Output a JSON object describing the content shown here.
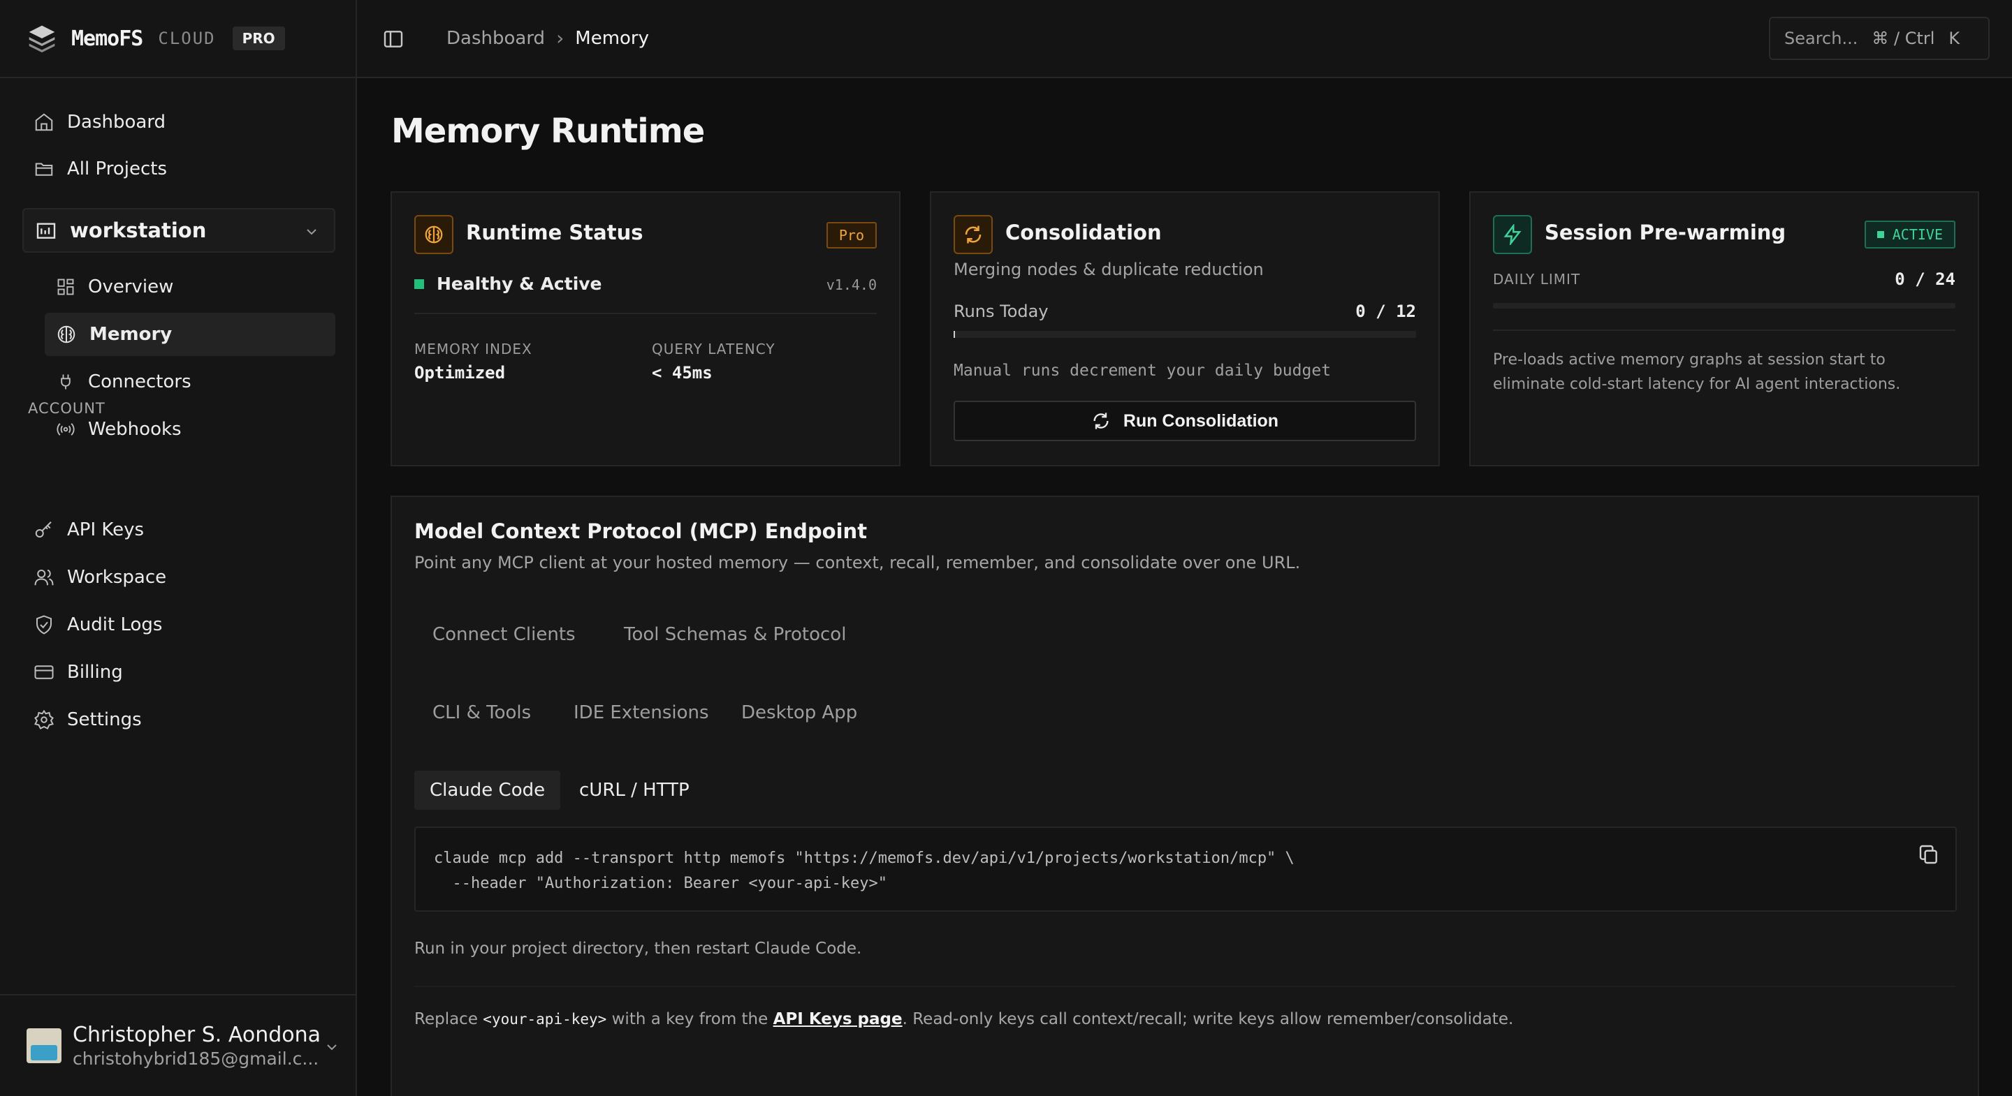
{
  "brand": {
    "name": "MemoFS",
    "suffix": "CLOUD",
    "plan": "PRO"
  },
  "sidebar": {
    "top_items": [
      {
        "label": "Dashboard",
        "icon": "home-icon"
      },
      {
        "label": "All Projects",
        "icon": "folder-icon"
      }
    ],
    "workspace": {
      "label": "workstation"
    },
    "project_items": [
      {
        "label": "Overview",
        "icon": "grid-icon"
      },
      {
        "label": "Memory",
        "icon": "brain-icon",
        "active": true
      },
      {
        "label": "Connectors",
        "icon": "plug-icon"
      },
      {
        "label": "Webhooks",
        "icon": "broadcast-icon"
      }
    ],
    "account_label": "ACCOUNT",
    "account_items": [
      {
        "label": "API Keys",
        "icon": "key-icon"
      },
      {
        "label": "Workspace",
        "icon": "users-icon"
      },
      {
        "label": "Audit Logs",
        "icon": "shield-icon"
      },
      {
        "label": "Billing",
        "icon": "credit-card-icon"
      },
      {
        "label": "Settings",
        "icon": "gear-icon"
      }
    ],
    "user": {
      "name": "Christopher S. Aondona",
      "email": "christohybrid185@gmail.c..."
    }
  },
  "topbar": {
    "breadcrumb": [
      "Dashboard",
      "Memory"
    ],
    "search": {
      "placeholder": "Search...",
      "shortcut": "⌘ / Ctrl",
      "key": "K"
    }
  },
  "page": {
    "title": "Memory Runtime"
  },
  "runtime_status": {
    "title": "Runtime Status",
    "badge": "Pro",
    "status": "Healthy & Active",
    "version": "v1.4.0",
    "memory_index_label": "MEMORY INDEX",
    "memory_index_value": "Optimized",
    "query_latency_label": "QUERY LATENCY",
    "query_latency_value": "< 45ms",
    "status_color": "#22c07a"
  },
  "consolidation": {
    "title": "Consolidation",
    "subtitle": "Merging nodes & duplicate reduction",
    "runs_label": "Runs Today",
    "runs_value": "0 / 12",
    "runs_fraction": 0,
    "note": "Manual runs decrement your daily budget",
    "button": "Run Consolidation",
    "accent": "#f0a53a"
  },
  "prewarming": {
    "title": "Session Pre-warming",
    "badge": "ACTIVE",
    "limit_label": "DAILY LIMIT",
    "limit_value": "0 / 24",
    "limit_fraction": 0,
    "description_line1": "Pre-loads active memory graphs at session start to",
    "description_line2": "eliminate cold-start latency for AI agent interactions.",
    "accent": "#3fd39a"
  },
  "mcp": {
    "title": "Model Context Protocol (MCP) Endpoint",
    "subtitle": "Point any MCP client at your hosted memory — context, recall, remember, and consolidate over one URL.",
    "tabs_row1": [
      "Connect Clients",
      "Tool Schemas & Protocol"
    ],
    "tabs_row2": [
      "CLI & Tools",
      "IDE Extensions",
      "Desktop App"
    ],
    "subtabs": [
      "Claude Code",
      "cURL / HTTP"
    ],
    "code_line1": "claude mcp add --transport http memofs \"https://memofs.dev/api/v1/projects/workstation/mcp\" \\",
    "code_line2": "  --header \"Authorization: Bearer <your-api-key>\"",
    "hint": "Run in your project directory, then restart Claude Code.",
    "replace_prefix": "Replace ",
    "replace_code": "<your-api-key>",
    "replace_middle": " with a key from the ",
    "replace_link": "API Keys page",
    "replace_suffix": ". Read-only keys call context/recall; write keys allow remember/consolidate."
  }
}
